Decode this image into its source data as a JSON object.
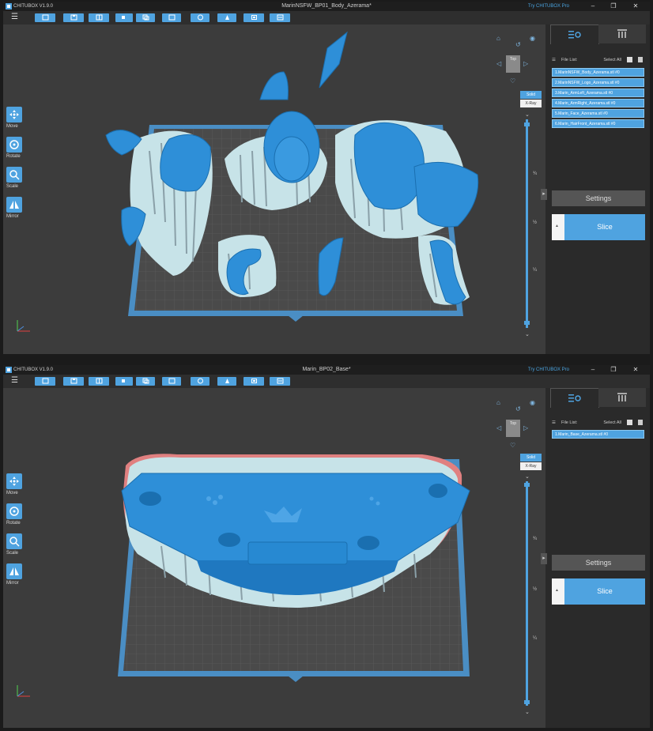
{
  "colors": {
    "accent": "#4fa3e0",
    "model": "#2e8fd8",
    "support_base": "#c7e3e8",
    "plate_edge": "#4a8ec4"
  },
  "windows": [
    {
      "app_name": "CHITUBOX V1.9.0",
      "title": "MarinNSFW_BP01_Body_Azerama*",
      "try_pro": "Try CHITUBOX Pro",
      "tools": [
        {
          "label": "Move",
          "icon": "move-icon"
        },
        {
          "label": "Rotate",
          "icon": "rotate-icon"
        },
        {
          "label": "Scale",
          "icon": "scale-icon"
        },
        {
          "label": "Mirror",
          "icon": "mirror-icon"
        }
      ],
      "navcube_face": "Top",
      "render_modes": {
        "solid": "Solid",
        "xray": "X-Ray"
      },
      "slider_marks": [
        "¾",
        "½",
        "¼"
      ],
      "file_list_label": "File List:",
      "select_all": "Select All",
      "files": [
        "1.MarinNSFW_Body_Azerama.stl #0",
        "2.MarinNSFW_Logo_Azerama.stl #0",
        "3.Marin_ArmLeft_Azerama.stl #0",
        "4.Marin_ArmRight_Azerama.stl #0",
        "5.Marin_Face_Azerama.stl #0",
        "6.Marin_HairFront_Azerama.stl #0"
      ],
      "settings_label": "Settings",
      "slice_label": "Slice"
    },
    {
      "app_name": "CHITUBOX V1.9.0",
      "title": "Marin_BP02_Base*",
      "try_pro": "Try CHITUBOX Pro",
      "tools": [
        {
          "label": "Move",
          "icon": "move-icon"
        },
        {
          "label": "Rotate",
          "icon": "rotate-icon"
        },
        {
          "label": "Scale",
          "icon": "scale-icon"
        },
        {
          "label": "Mirror",
          "icon": "mirror-icon"
        }
      ],
      "navcube_face": "Top",
      "render_modes": {
        "solid": "Solid",
        "xray": "X-Ray"
      },
      "slider_marks": [
        "¾",
        "½",
        "¼"
      ],
      "file_list_label": "File List:",
      "select_all": "Select All",
      "files": [
        "1.Marin_Base_Azerama.stl #0"
      ],
      "settings_label": "Settings",
      "slice_label": "Slice"
    }
  ]
}
